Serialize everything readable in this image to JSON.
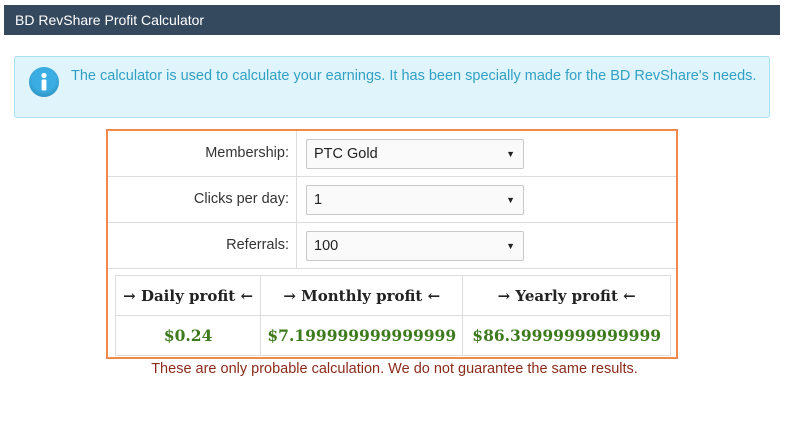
{
  "title": "BD RevShare Profit Calculator",
  "info": {
    "icon": "info-icon",
    "text": "The calculator is used to calculate your earnings. It has been specially made for the BD RevShare's needs."
  },
  "form": {
    "membership": {
      "label": "Membership:",
      "value": "PTC Gold"
    },
    "clicks": {
      "label": "Clicks per day:",
      "value": "1"
    },
    "referrals": {
      "label": "Referrals:",
      "value": "100"
    }
  },
  "results": {
    "daily_header": "→ Daily profit ←",
    "monthly_header": "→ Monthly profit ←",
    "yearly_header": "→ Yearly profit ←",
    "daily_value": "$0.24",
    "monthly_value": "$7.199999999999999",
    "yearly_value": "$86.39999999999999"
  },
  "note": "These are only probable calculation. We do not guarantee the same results.",
  "colors": {
    "titlebar": "#34495e",
    "info_bg": "#dff4fb",
    "calc_border": "#f08a4b",
    "profit": "#3d7a1d",
    "note": "#8b2b1a"
  }
}
